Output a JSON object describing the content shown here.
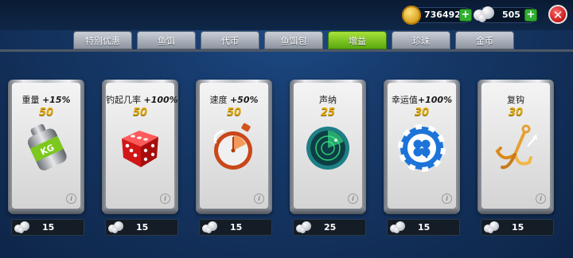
{
  "currency": {
    "coins": "736492",
    "pearls": "505",
    "coin_icon": "gold-coin-icon",
    "pearl_icon": "pearl-icon"
  },
  "close_label": "✕",
  "tabs": [
    {
      "label": "特别优惠",
      "active": false
    },
    {
      "label": "鱼饵",
      "active": false
    },
    {
      "label": "代币",
      "active": false
    },
    {
      "label": "鱼饵包",
      "active": false
    },
    {
      "label": "增益",
      "active": true
    },
    {
      "label": "珍珠",
      "active": false
    },
    {
      "label": "金币",
      "active": false
    }
  ],
  "cards": [
    {
      "name": "重量",
      "bonus": "+15%",
      "cost": "50",
      "price": "15",
      "icon": "kg-weight-icon"
    },
    {
      "name": "钓起几率",
      "bonus": "+100%",
      "cost": "50",
      "price": "15",
      "icon": "red-dice-icon"
    },
    {
      "name": "速度",
      "bonus": "+50%",
      "cost": "50",
      "price": "15",
      "icon": "stopwatch-icon"
    },
    {
      "name": "声纳",
      "bonus": "",
      "cost": "25",
      "price": "25",
      "icon": "sonar-radar-icon"
    },
    {
      "name": "幸运值",
      "bonus": "+100%",
      "cost": "30",
      "price": "15",
      "icon": "lucky-clover-chip-icon"
    },
    {
      "name": "复钩",
      "bonus": "",
      "cost": "30",
      "price": "15",
      "icon": "treble-hook-icon"
    }
  ],
  "info_label": "i",
  "colors": {
    "active_tab": "#6cc01e",
    "cost": "#e2a90a",
    "accent_plus": "#2fae2f"
  }
}
